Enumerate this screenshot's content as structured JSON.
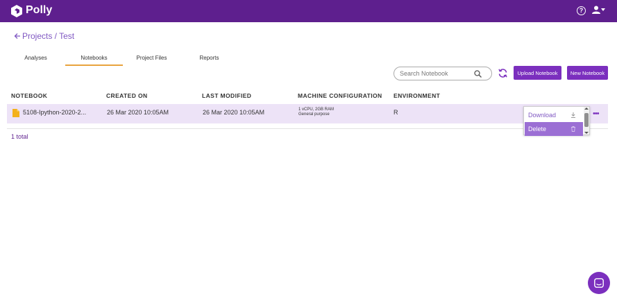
{
  "app": {
    "name": "Polly"
  },
  "breadcrumb": {
    "text": "Projects / Test"
  },
  "tabs": [
    {
      "label": "Analyses",
      "active": false
    },
    {
      "label": "Notebooks",
      "active": true
    },
    {
      "label": "Project Files",
      "active": false
    },
    {
      "label": "Reports",
      "active": false
    }
  ],
  "toolbar": {
    "search_placeholder": "Search Notebook",
    "upload_label": "Upload Notebook",
    "new_label": "New Notebook"
  },
  "table": {
    "columns": [
      "NOTEBOOK",
      "CREATED ON",
      "LAST MODIFIED",
      "MACHINE CONFIGURATION",
      "ENVIRONMENT"
    ],
    "rows": [
      {
        "name": "5108-Ipython-2020-2...",
        "created": "26 Mar 2020 10:05AM",
        "modified": "26 Mar 2020 10:05AM",
        "config_line1": "1 vCPU, 2GB RAM",
        "config_line2": "General purpose",
        "environment": "R"
      }
    ],
    "total": "1 total"
  },
  "row_menu": {
    "items": [
      {
        "label": "Download",
        "icon": "download-icon"
      },
      {
        "label": "Delete",
        "icon": "trash-icon"
      }
    ]
  },
  "colors": {
    "brand": "#5e1f8e",
    "accent": "#7b2fbe",
    "tab_underline": "#e8a33c",
    "row_highlight": "#ede3f7"
  }
}
